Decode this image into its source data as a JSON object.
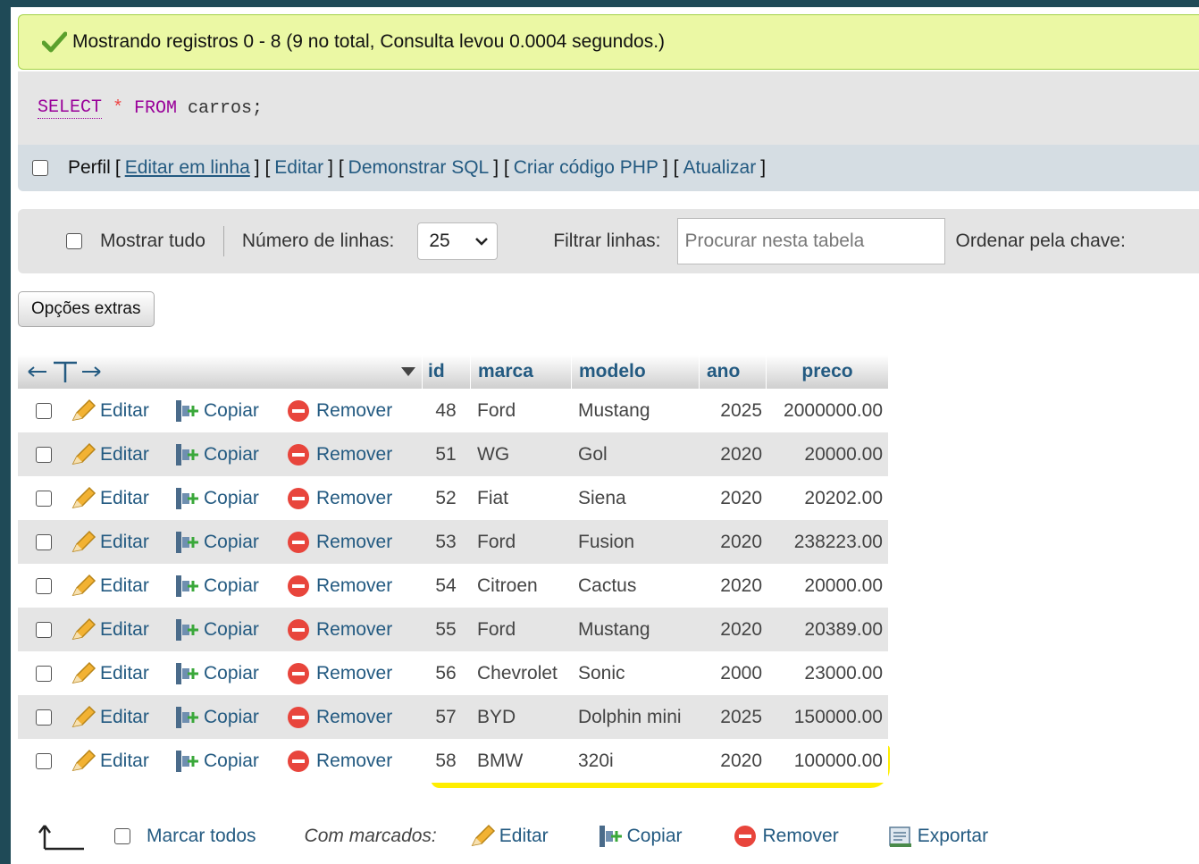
{
  "success": {
    "message": "Mostrando registros 0 - 8 (9 no total, Consulta levou 0.0004 segundos.)"
  },
  "sql": {
    "select": "SELECT",
    "star": "*",
    "from": "FROM",
    "table": "carros;"
  },
  "links": {
    "perfil": "Perfil",
    "editar_em_linha": "Editar em linha",
    "editar": "Editar",
    "demonstrar_sql": "Demonstrar SQL",
    "criar_codigo_php": "Criar código PHP",
    "atualizar": "Atualizar"
  },
  "nav": {
    "mostrar_tudo": "Mostrar tudo",
    "numero_linhas": "Número de linhas:",
    "rows_value": "25",
    "filtrar_linhas": "Filtrar linhas:",
    "filter_placeholder": "Procurar nesta tabela",
    "ordenar": "Ordenar pela chave:"
  },
  "extras_button": "Opções extras",
  "columns": [
    "id",
    "marca",
    "modelo",
    "ano",
    "preco"
  ],
  "actions": {
    "edit": "Editar",
    "copy": "Copiar",
    "remove": "Remover"
  },
  "rows": [
    {
      "id": "48",
      "marca": "Ford",
      "modelo": "Mustang",
      "ano": "2025",
      "preco": "2000000.00"
    },
    {
      "id": "51",
      "marca": "WG",
      "modelo": "Gol",
      "ano": "2020",
      "preco": "20000.00"
    },
    {
      "id": "52",
      "marca": "Fiat",
      "modelo": "Siena",
      "ano": "2020",
      "preco": "20202.00"
    },
    {
      "id": "53",
      "marca": "Ford",
      "modelo": "Fusion",
      "ano": "2020",
      "preco": "238223.00"
    },
    {
      "id": "54",
      "marca": "Citroen",
      "modelo": "Cactus",
      "ano": "2020",
      "preco": "20000.00"
    },
    {
      "id": "55",
      "marca": "Ford",
      "modelo": "Mustang",
      "ano": "2020",
      "preco": "20389.00"
    },
    {
      "id": "56",
      "marca": "Chevrolet",
      "modelo": "Sonic",
      "ano": "2000",
      "preco": "23000.00"
    },
    {
      "id": "57",
      "marca": "BYD",
      "modelo": "Dolphin mini",
      "ano": "2025",
      "preco": "150000.00"
    },
    {
      "id": "58",
      "marca": "BMW",
      "modelo": "320i",
      "ano": "2020",
      "preco": "100000.00"
    }
  ],
  "footer": {
    "marcar_todos": "Marcar todos",
    "com_marcados": "Com marcados:",
    "editar": "Editar",
    "copiar": "Copiar",
    "remover": "Remover",
    "exportar": "Exportar"
  },
  "colors": {
    "link": "#235a81",
    "success_bg": "#ebf8a4",
    "highlight": "#ffee00"
  }
}
